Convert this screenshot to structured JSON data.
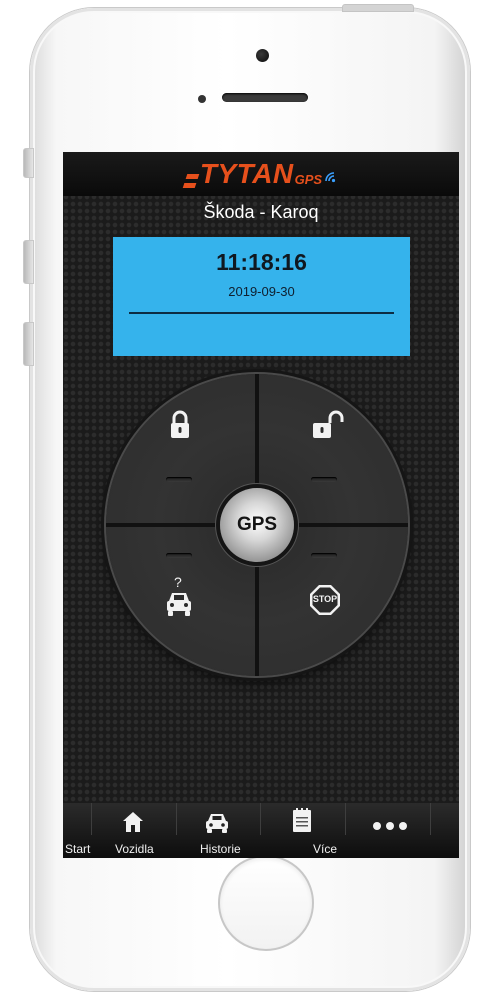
{
  "app": {
    "logo": {
      "brand": "TYTAN",
      "suffix": "GPS"
    },
    "vehicle_title": "Škoda - Karoq",
    "status": {
      "time": "11:18:16",
      "date": "2019-09-30"
    },
    "controls": {
      "center_label": "GPS",
      "lock": "lock-icon",
      "unlock": "unlock-icon",
      "locate": "car-question-icon",
      "stop": "stop-sign-icon",
      "stop_label": "STOP"
    },
    "tabs": [
      {
        "label": "Start",
        "icon": ""
      },
      {
        "label": "Vozidla",
        "icon": "home-icon"
      },
      {
        "label": "Historie",
        "icon": "car-icon"
      },
      {
        "label": "Více",
        "icon": "notepad-icon"
      },
      {
        "label": "",
        "icon": "more-dots-icon"
      }
    ]
  },
  "colors": {
    "accent": "#e6501c",
    "panel": "#35b3ec",
    "screen_bg": "#1b1b1b",
    "signal": "#3aa0ff"
  }
}
